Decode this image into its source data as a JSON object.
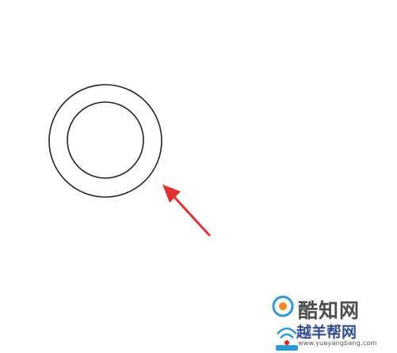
{
  "figure": {
    "outer_circle": {
      "stroke": "#222222"
    },
    "inner_circle": {
      "stroke": "#222222"
    },
    "arrow": {
      "color": "#e03131"
    }
  },
  "watermarks": {
    "line1": "酷知网",
    "line2": "越羊帮网",
    "url": "www.yueyangbang.com",
    "accent_colors": [
      "#2a9bd7",
      "#f08a24",
      "#e2231a"
    ]
  }
}
